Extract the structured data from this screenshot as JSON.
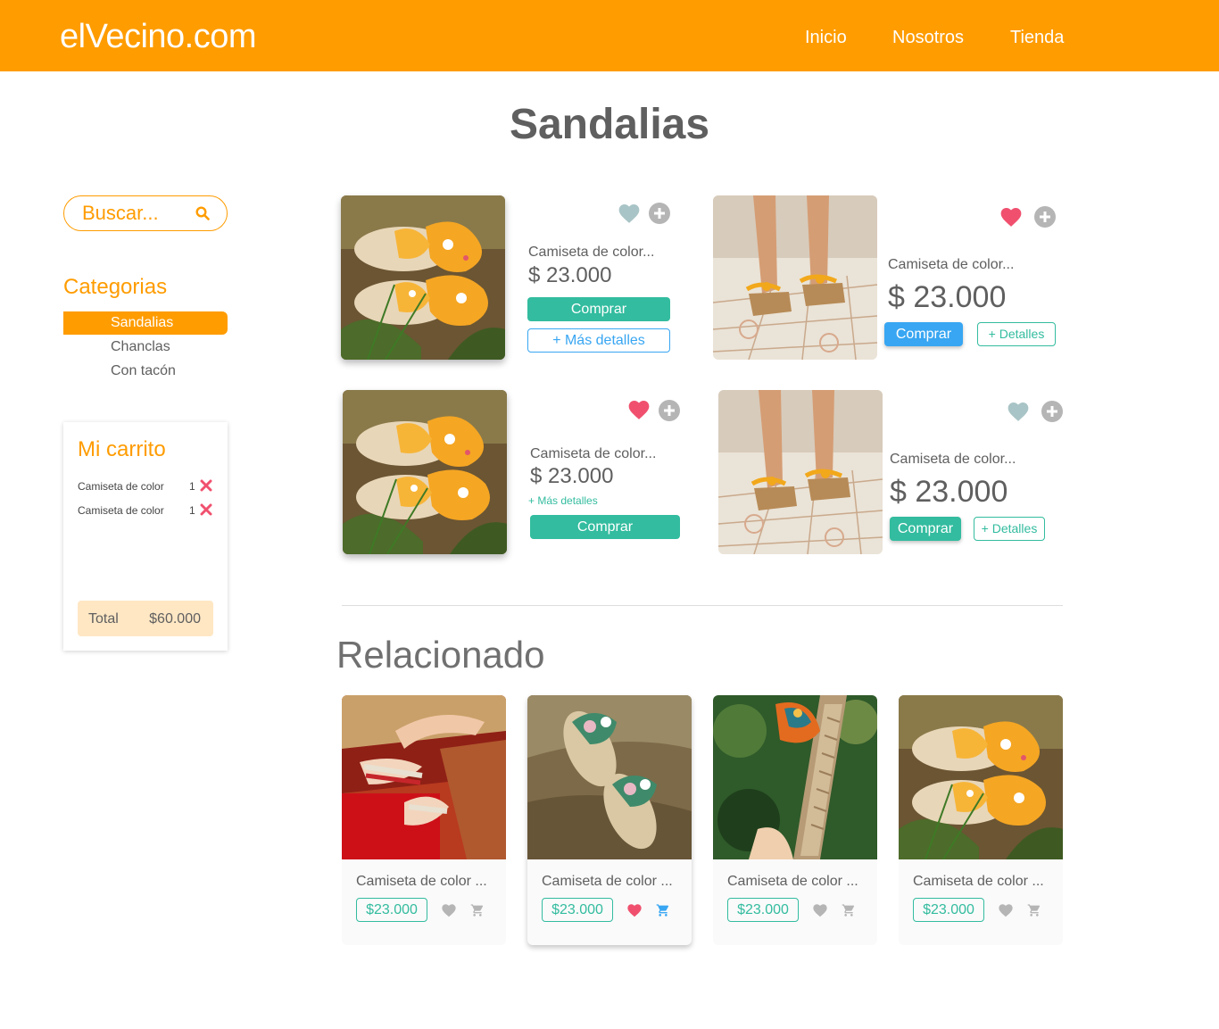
{
  "header": {
    "logo": "elVecino.com",
    "nav": [
      "Inicio",
      "Nosotros",
      "Tienda"
    ]
  },
  "page_title": "Sandalias",
  "sidebar": {
    "search_placeholder": "Buscar...",
    "categories_title": "Categorias",
    "categories": [
      {
        "label": "Sandalias",
        "active": true
      },
      {
        "label": "Chanclas",
        "active": false
      },
      {
        "label": "Con tacón",
        "active": false
      }
    ]
  },
  "cart": {
    "title": "Mi carrito",
    "items": [
      {
        "name": "Camiseta de color",
        "qty": "1"
      },
      {
        "name": "Camiseta de color",
        "qty": "1"
      }
    ],
    "total_label": "Total",
    "total_value": "$60.000"
  },
  "products": [
    {
      "name": "Camiseta de color...",
      "price": "$ 23.000",
      "liked": false,
      "buy_label": "Comprar",
      "details_label": "+ Más detalles",
      "image": "orange-bow-sandals"
    },
    {
      "name": "Camiseta de color...",
      "price": "$ 23.000",
      "liked": true,
      "buy_label": "Comprar",
      "details_label": "+ Detalles",
      "image": "wedge-sandals"
    },
    {
      "name": "Camiseta de color...",
      "price": "$ 23.000",
      "liked": true,
      "buy_label": "Comprar",
      "details_label": "+ Más detalles",
      "image": "orange-bow-sandals"
    },
    {
      "name": "Camiseta de color...",
      "price": "$ 23.000",
      "liked": false,
      "buy_label": "Comprar",
      "details_label": "+ Detalles",
      "image": "wedge-sandals"
    }
  ],
  "related": {
    "title": "Relacionado",
    "items": [
      {
        "name": "Camiseta de color ...",
        "price": "$23.000",
        "liked": false,
        "in_cart": false,
        "image": "red-sandals-on-rug"
      },
      {
        "name": "Camiseta de color ...",
        "price": "$23.000",
        "liked": true,
        "in_cart": true,
        "image": "floral-bow-slides"
      },
      {
        "name": "Camiseta de color ...",
        "price": "$23.000",
        "liked": false,
        "in_cart": false,
        "image": "espadrille-wedge"
      },
      {
        "name": "Camiseta de color ...",
        "price": "$23.000",
        "liked": false,
        "in_cart": false,
        "image": "orange-bow-sandals"
      }
    ]
  },
  "colors": {
    "brand": "#ff9c00",
    "green": "#33bc9f",
    "blue": "#38a6f2",
    "heart_active": "#f0506e",
    "heart_inactive": "#a9c4c6",
    "text": "#5f5f5f"
  }
}
